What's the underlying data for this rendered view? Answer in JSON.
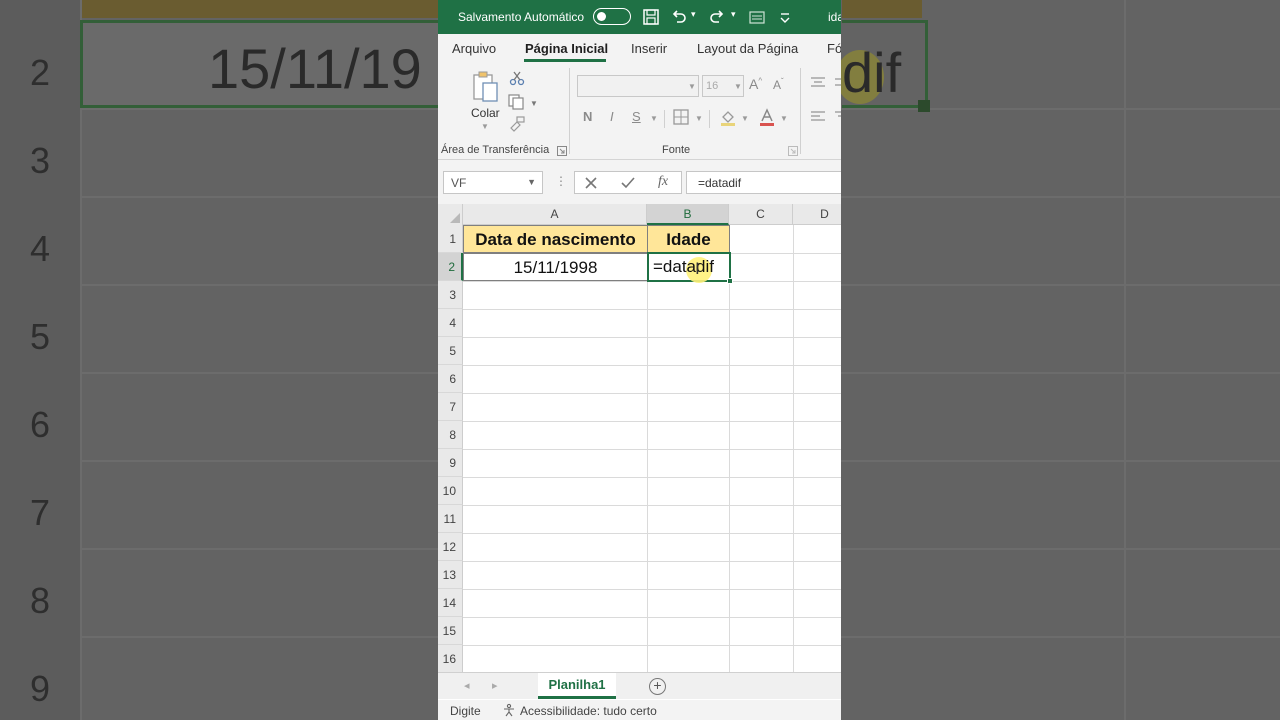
{
  "titlebar": {
    "autosave_label": "Salvamento Automático",
    "file_name": "ida"
  },
  "ribbon_tabs": [
    {
      "label": "Arquivo"
    },
    {
      "label": "Página Inicial"
    },
    {
      "label": "Inserir"
    },
    {
      "label": "Layout da Página"
    },
    {
      "label": "Fó"
    }
  ],
  "ribbon": {
    "paste_label": "Colar",
    "clipboard_group": "Área de Transferência",
    "font_group": "Fonte",
    "font_size": "16",
    "bold": "N",
    "italic": "I",
    "underline": "S"
  },
  "formula_bar": {
    "name_box": "VF",
    "formula": "=datadif"
  },
  "grid": {
    "columns": [
      "A",
      "B",
      "C",
      "D"
    ],
    "rows": [
      "1",
      "2",
      "3",
      "4",
      "5",
      "6",
      "7",
      "8",
      "9",
      "10",
      "11",
      "12",
      "13",
      "14",
      "15",
      "16"
    ],
    "header_a": "Data de nascimento",
    "header_b": "Idade",
    "birth_date": "15/11/1998",
    "editing_formula": "=datadif"
  },
  "sheets": {
    "active": "Planilha1"
  },
  "status": {
    "mode": "Digite",
    "accessibility": "Acessibilidade: tudo certo"
  },
  "background": {
    "row_numbers": [
      "2",
      "3",
      "4",
      "5",
      "6",
      "7",
      "8",
      "9"
    ],
    "date_fragment": "15/11/19",
    "formula_fragment": "dif"
  },
  "colors": {
    "excel_green": "#1f7145",
    "header_fill": "#ffe699"
  }
}
